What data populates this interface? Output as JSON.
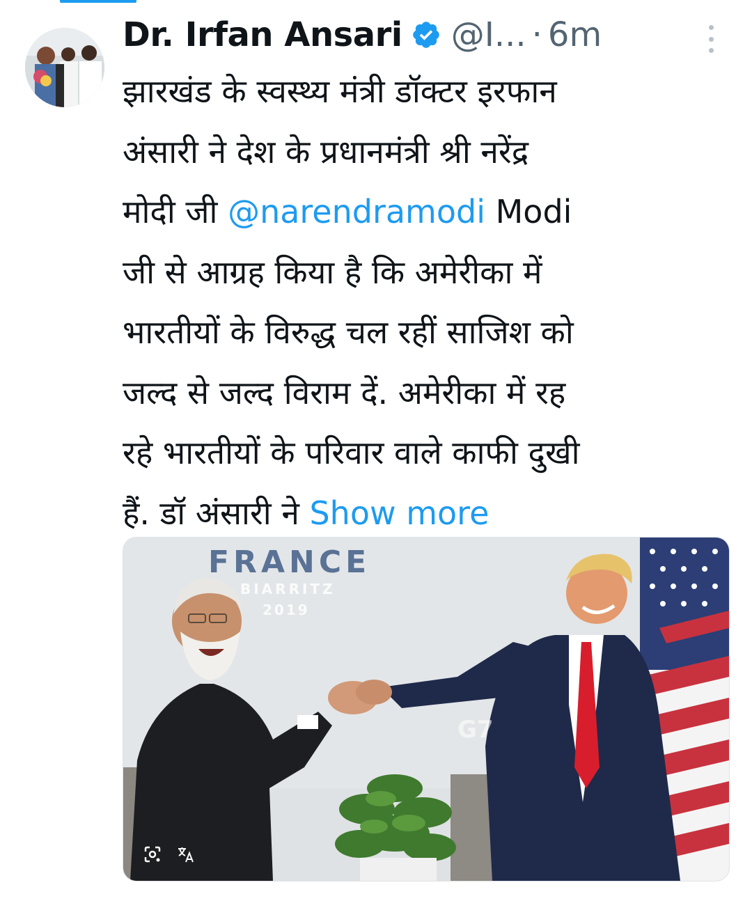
{
  "tweet": {
    "author_name": "Dr. Irfan Ansari",
    "handle": "@I...",
    "separator": "·",
    "time": "6m",
    "text_line1": "झारखंड के स्वस्थ्य मंत्री डॉक्टर इरफान",
    "text_line2": "अंसारी ने देश के प्रधानमंत्री श्री नरेंद्र",
    "text_line3_pre": "मोदी जी ",
    "mention": "@narendramodi",
    "text_line3_post": " Modi",
    "text_line4": "जी से आग्रह किया है कि अमेरीका में",
    "text_line5": "भारतीयों के विरुद्ध चल रहीं साजिश को",
    "text_line6": "जल्द से जल्द विराम दें. अमेरीका में रह",
    "text_line7": "रहे भारतीयों के परिवार वाले काफी दुखी",
    "text_line8_pre": "हैं. डॉ अंसारी ने ",
    "show_more": "Show more"
  },
  "media": {
    "backdrop_text": "FRANCE",
    "backdrop_sub": "BIARRITZ",
    "backdrop_year": "2019",
    "podium_text": "G7"
  },
  "icons": {
    "verified": "verified-badge-icon",
    "more": "more-vertical-icon",
    "lens": "google-lens-icon",
    "translate": "translate-icon"
  },
  "colors": {
    "link": "#1d9bf0",
    "secondary_text": "#536471",
    "primary_text": "#0f1419"
  }
}
